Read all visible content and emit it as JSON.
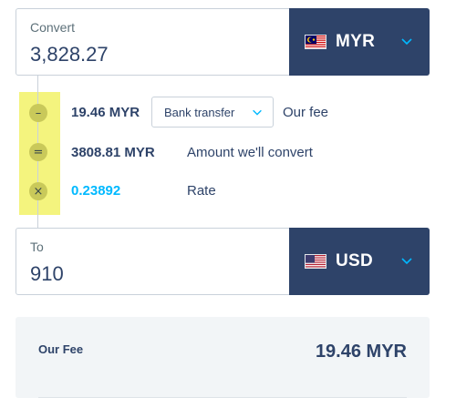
{
  "source": {
    "label": "Convert",
    "amount": "3,828.27",
    "currency": "MYR",
    "flag_icon": "malaysia-flag-icon"
  },
  "breakdown": {
    "fee": {
      "operator": "–",
      "value": "19.46 MYR",
      "method": "Bank transfer",
      "label": "Our fee"
    },
    "convert": {
      "operator": "=",
      "value": "3808.81 MYR",
      "label": "Amount we'll convert"
    },
    "rate": {
      "operator": "×",
      "value": "0.23892",
      "label": "Rate"
    }
  },
  "target": {
    "label": "To",
    "amount": "910",
    "currency": "USD",
    "flag_icon": "usa-flag-icon"
  },
  "summary": {
    "fee_label": "Our Fee",
    "fee_value": "19.46 MYR"
  },
  "colors": {
    "navy": "#2e4369",
    "accent_blue": "#00b9ff",
    "highlight": "#f4f47e"
  }
}
